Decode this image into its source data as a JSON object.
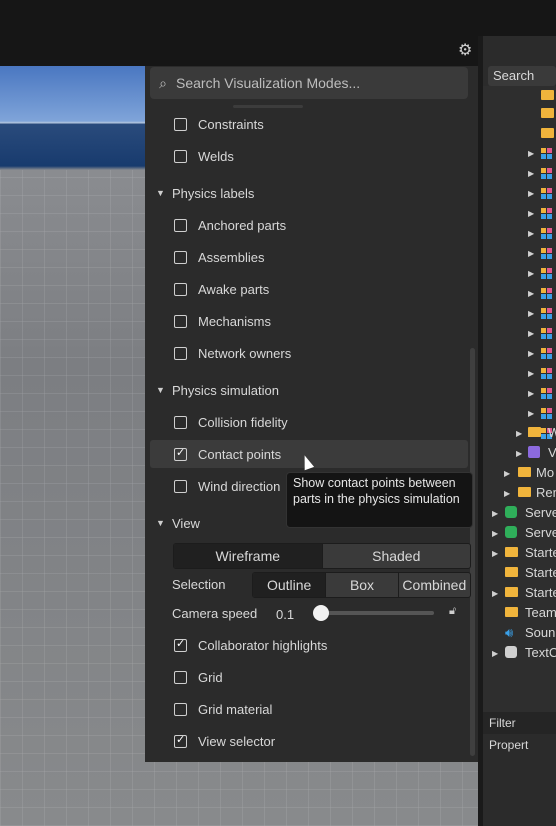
{
  "search": {
    "placeholder": "Search Visualization Modes..."
  },
  "items_top": [
    {
      "label": "Constraints",
      "checked": false
    },
    {
      "label": "Welds",
      "checked": false
    }
  ],
  "physics_labels": {
    "title": "Physics labels",
    "items": [
      {
        "label": "Anchored parts",
        "checked": false
      },
      {
        "label": "Assemblies",
        "checked": false
      },
      {
        "label": "Awake parts",
        "checked": false
      },
      {
        "label": "Mechanisms",
        "checked": false
      },
      {
        "label": "Network owners",
        "checked": false
      }
    ]
  },
  "physics_simulation": {
    "title": "Physics simulation",
    "items": [
      {
        "label": "Collision fidelity",
        "checked": false
      },
      {
        "label": "Contact points",
        "checked": true
      },
      {
        "label": "Wind direction",
        "checked": false
      }
    ]
  },
  "tooltip": "Show contact points between parts in the physics simulation",
  "view": {
    "title": "View",
    "render_modes": [
      "Wireframe",
      "Shaded"
    ],
    "selection_label": "Selection",
    "selection_modes": [
      "Outline",
      "Box",
      "Combined"
    ],
    "camera_speed_label": "Camera speed",
    "camera_speed_value": "0.1",
    "items": [
      {
        "label": "Collaborator highlights",
        "checked": true
      },
      {
        "label": "Grid",
        "checked": false
      },
      {
        "label": "Grid material",
        "checked": false
      },
      {
        "label": "View selector",
        "checked": true
      }
    ]
  },
  "explorer": {
    "search_label": "Search",
    "items": [
      "W",
      "V",
      "Mo",
      "Ren",
      "Serve",
      "Serve",
      "Starte",
      "Starte",
      "Starte",
      "Team",
      "Soun",
      "TextC"
    ],
    "filter_label": "Filter Propert"
  }
}
